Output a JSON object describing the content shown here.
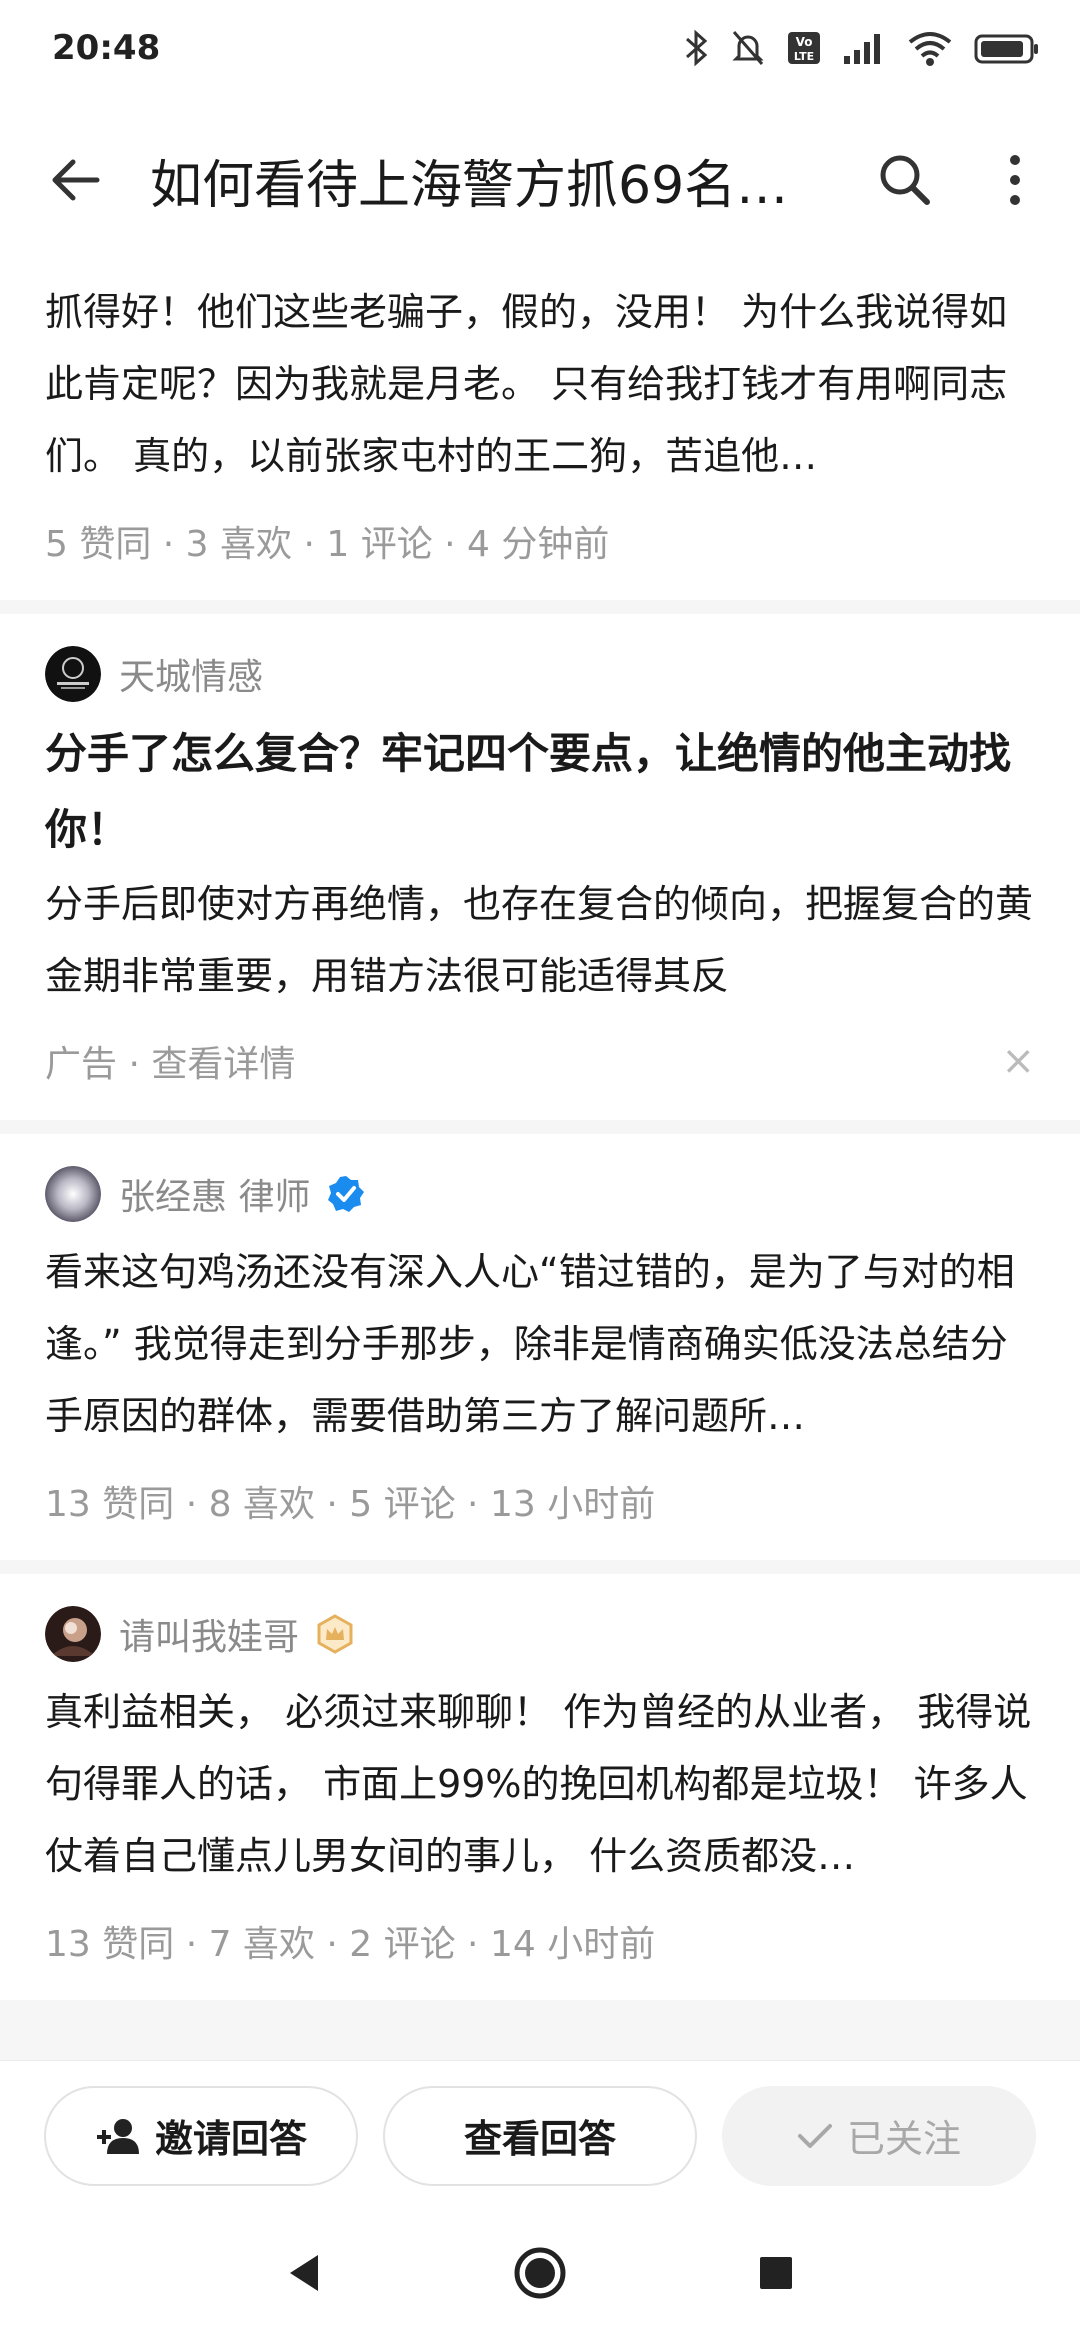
{
  "status_bar": {
    "time": "20:48",
    "lte_label": "LTE",
    "volte_label": "Vo"
  },
  "app_bar": {
    "title": "如何看待上海警方抓69名…"
  },
  "answers_top": {
    "text": "抓得好！他们这些老骗子，假的，没用！ 为什么我说得如此肯定呢？因为我就是月老。 只有给我打钱才有用啊同志们。 真的，以前张家屯村的王二狗，苦追他…",
    "meta": "5 赞同 · 3 喜欢 · 1 评论 · 4 分钟前"
  },
  "ad": {
    "author": "天城情感",
    "title": "分手了怎么复合？牢记四个要点，让绝情的他主动找你！",
    "text": "分手后即使对方再绝情，也存在复合的倾向，把握复合的黄金期非常重要，用错方法很可能适得其反",
    "meta": "广告 · 查看详情",
    "close": "×"
  },
  "answer2": {
    "author": "张经惠 律师",
    "text": "看来这句鸡汤还没有深入人心“错过错的，是为了与对的相逢。” 我觉得走到分手那步，除非是情商确实低没法总结分手原因的群体，需要借助第三方了解问题所…",
    "meta": "13 赞同 · 8 喜欢 · 5 评论 · 13 小时前"
  },
  "answer3": {
    "author": "请叫我娃哥",
    "text": "真利益相关， 必须过来聊聊！ 作为曾经的从业者， 我得说句得罪人的话， 市面上99%的挽回机构都是垃圾！ 许多人仗着自己懂点儿男女间的事儿， 什么资质都没…",
    "meta": "13 赞同 · 7 喜欢 · 2 评论 · 14 小时前"
  },
  "action_bar": {
    "invite": "邀请回答",
    "view": "查看回答",
    "followed": "已关注"
  },
  "colors": {
    "verified_blue": "#1a8cf0",
    "badge_gold": "#e5b15c",
    "meta_gray": "#9a9a9a"
  }
}
